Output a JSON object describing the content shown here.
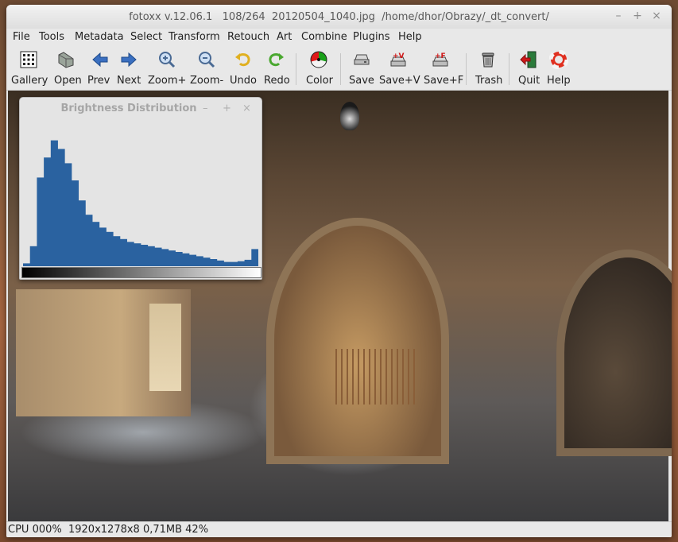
{
  "window": {
    "title": "fotoxx v.12.06.1   108/264  20120504_1040.jpg  /home/dhor/Obrazy/_dt_convert/",
    "minimize_glyph": "–",
    "maximize_glyph": "+",
    "close_glyph": "×"
  },
  "menu": [
    "File",
    "Tools",
    "Metadata",
    "Select",
    "Transform",
    "Retouch",
    "Art",
    "Combine",
    "Plugins",
    "Help"
  ],
  "toolbar": [
    {
      "label": "Gallery",
      "icon": "gallery-icon"
    },
    {
      "label": "Open",
      "icon": "open-icon"
    },
    {
      "label": "Prev",
      "icon": "prev-arrow-icon"
    },
    {
      "label": "Next",
      "icon": "next-arrow-icon"
    },
    {
      "label": "Zoom+",
      "icon": "zoom-in-icon"
    },
    {
      "label": "Zoom-",
      "icon": "zoom-out-icon"
    },
    {
      "label": "Undo",
      "icon": "undo-icon"
    },
    {
      "label": "Redo",
      "icon": "redo-icon"
    },
    {
      "label": "Color",
      "icon": "color-wheel-icon"
    },
    {
      "label": "Save",
      "icon": "save-icon"
    },
    {
      "label": "Save+V",
      "icon": "save-version-icon"
    },
    {
      "label": "Save+F",
      "icon": "save-file-icon"
    },
    {
      "label": "Trash",
      "icon": "trash-icon"
    },
    {
      "label": "Quit",
      "icon": "quit-icon"
    },
    {
      "label": "Help",
      "icon": "help-icon"
    }
  ],
  "histogram": {
    "title": "Brightness Distribution",
    "minimize_glyph": "–",
    "maximize_glyph": "+",
    "close_glyph": "×",
    "bar_color": "#2a62a0",
    "bins": [
      0.02,
      0.14,
      0.62,
      0.76,
      0.88,
      0.82,
      0.72,
      0.6,
      0.46,
      0.36,
      0.31,
      0.27,
      0.24,
      0.21,
      0.19,
      0.17,
      0.16,
      0.15,
      0.14,
      0.13,
      0.12,
      0.11,
      0.1,
      0.09,
      0.08,
      0.07,
      0.06,
      0.05,
      0.04,
      0.03,
      0.03,
      0.035,
      0.045,
      0.12
    ]
  },
  "status": {
    "text": "CPU 000%  1920x1278x8 0,71MB 42%"
  }
}
